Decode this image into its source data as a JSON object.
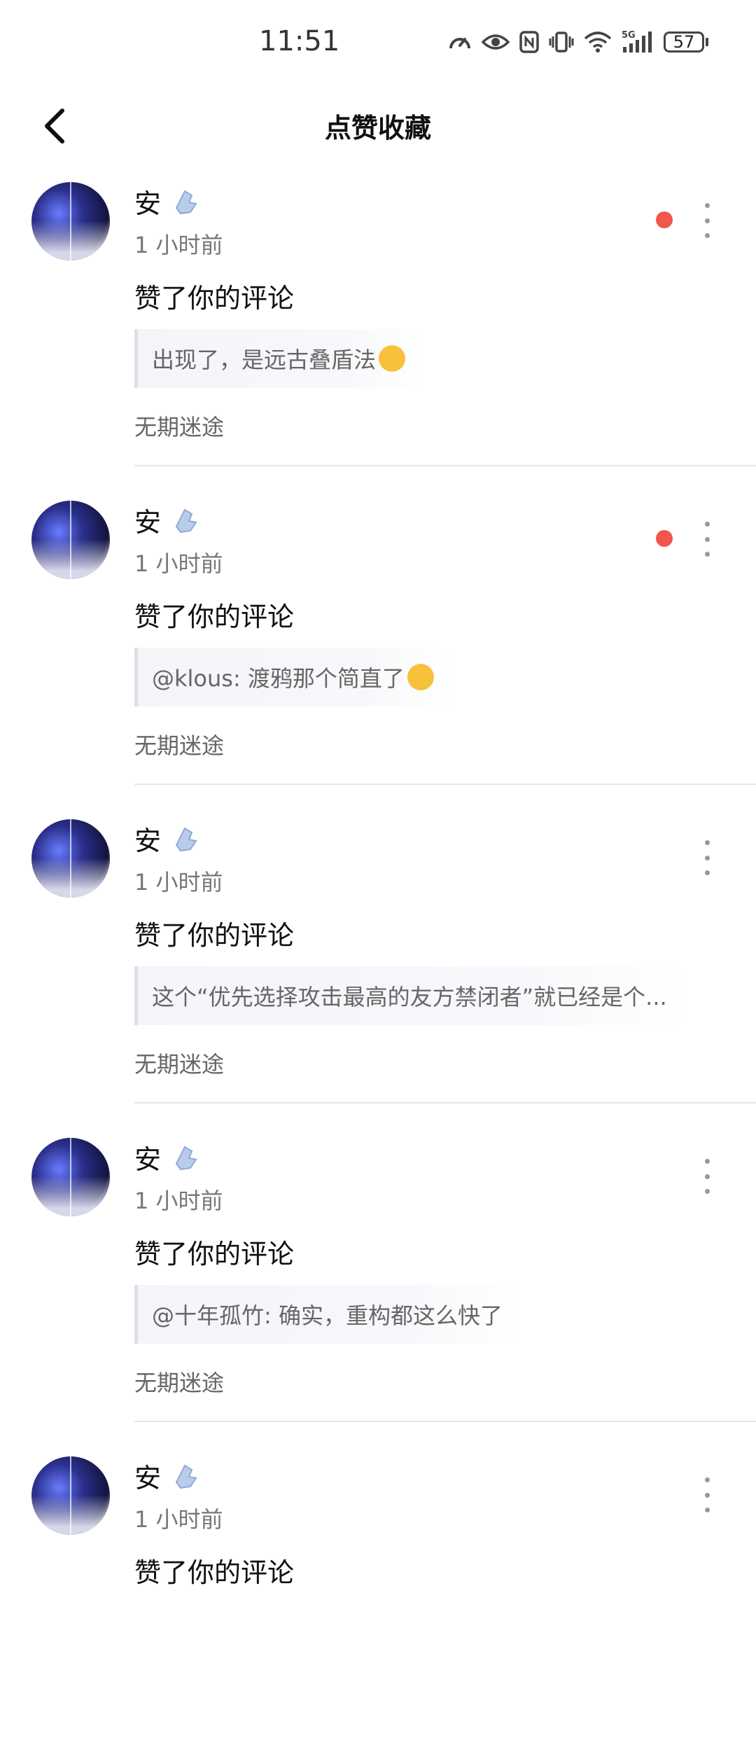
{
  "status_bar": {
    "time": "11:51",
    "battery": "57",
    "network": "5G",
    "icons": [
      "speedometer-icon",
      "eye-icon",
      "nfc-icon",
      "vibrate-icon",
      "wifi-icon",
      "signal-icon",
      "battery-icon"
    ]
  },
  "nav": {
    "title": "点赞收藏",
    "back_icon": "chevron-left-icon"
  },
  "items": [
    {
      "user": "安",
      "time": "1 小时前",
      "action": "赞了你的评论",
      "quote": "出现了，是远古叠盾法",
      "quote_emoji": "grinning-face-emoji",
      "source": "无期迷途",
      "unread": true
    },
    {
      "user": "安",
      "time": "1 小时前",
      "action": "赞了你的评论",
      "quote": "@klous: 渡鸦那个简直了",
      "quote_emoji": "surprised-face-emoji",
      "source": "无期迷途",
      "unread": true
    },
    {
      "user": "安",
      "time": "1 小时前",
      "action": "赞了你的评论",
      "quote": "这个“优先选择攻击最高的友方禁闭者”就已经是个...",
      "quote_emoji": "",
      "source": "无期迷途",
      "unread": false
    },
    {
      "user": "安",
      "time": "1 小时前",
      "action": "赞了你的评论",
      "quote": "@十年孤竹: 确实，重构都这么快了",
      "quote_emoji": "",
      "source": "无期迷途",
      "unread": false
    },
    {
      "user": "安",
      "time": "1 小时前",
      "action": "赞了你的评论",
      "quote": "",
      "quote_emoji": "",
      "source": "",
      "unread": false
    }
  ],
  "colors": {
    "unread_dot": "#f0564b",
    "quote_border": "#dcdfe8",
    "quote_bg": "#f4f5f9",
    "divider": "#e6e6e6"
  }
}
